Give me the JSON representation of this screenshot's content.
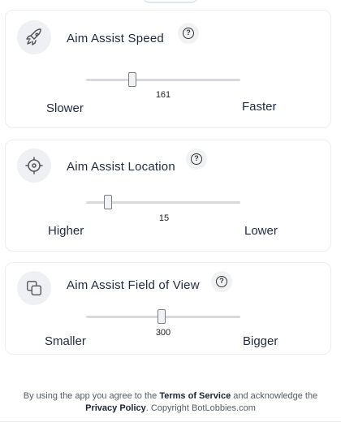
{
  "settings": [
    {
      "icon": "rocket-icon",
      "title": "Aim Assist Speed",
      "value": "161",
      "slider_fraction": 0.3,
      "min_label": "Slower",
      "max_label": "Faster"
    },
    {
      "icon": "crosshair-icon",
      "title": "Aim Assist Location",
      "value": "15",
      "slider_fraction": 0.14,
      "min_label": "Higher",
      "max_label": "Lower"
    },
    {
      "icon": "copy-icon",
      "title": "Aim Assist Field of View",
      "value": "300",
      "slider_fraction": 0.49,
      "min_label": "Smaller",
      "max_label": "Bigger"
    }
  ],
  "footer": {
    "prefix": "By using the app you agree to the",
    "terms": "Terms of Service",
    "middle": "and acknowledge the",
    "privacy": "Privacy Policy",
    "suffix": ". Copyright BotLobbies.com"
  }
}
